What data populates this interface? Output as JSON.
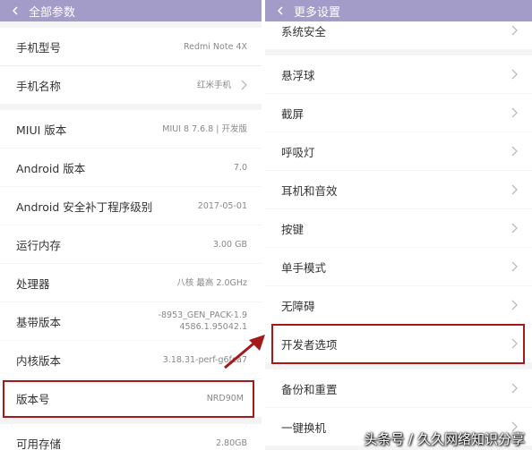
{
  "left": {
    "title": "全部参数",
    "rows": [
      {
        "label": "手机型号",
        "value": "Redmi Note 4X"
      },
      {
        "label": "手机名称",
        "value": "红米手机"
      },
      {
        "label": "MIUI 版本",
        "value": "MIUI 8 7.6.8 | 开发版"
      },
      {
        "label": "Android 版本",
        "value": "7.0"
      },
      {
        "label": "Android 安全补丁程序级别",
        "value": "2017-05-01"
      },
      {
        "label": "运行内存",
        "value": "3.00 GB"
      },
      {
        "label": "处理器",
        "value": "八核 最高 2.0GHz"
      },
      {
        "label": "基带版本",
        "value_line1": "-8953_GEN_PACK-1.9",
        "value_line2": "4586.1.95042.1"
      },
      {
        "label": "内核版本",
        "value": "3.18.31-perf-g6fca7"
      },
      {
        "label": "版本号",
        "value": "NRD90M"
      },
      {
        "label": "可用存储",
        "value": "2.80GB"
      }
    ]
  },
  "right": {
    "title": "更多设置",
    "items": [
      {
        "label": "系统安全"
      },
      {
        "label": "悬浮球"
      },
      {
        "label": "截屏"
      },
      {
        "label": "呼吸灯"
      },
      {
        "label": "耳机和音效"
      },
      {
        "label": "按键"
      },
      {
        "label": "单手模式"
      },
      {
        "label": "无障碍"
      },
      {
        "label": "开发者选项"
      },
      {
        "label": "备份和重置"
      },
      {
        "label": "一键换机"
      }
    ]
  },
  "watermark": "头条号 / 久久网络知识分享",
  "colors": {
    "topbar": "#a39bc8",
    "highlight": "#a41a1a",
    "background": "#f4f4f4"
  }
}
